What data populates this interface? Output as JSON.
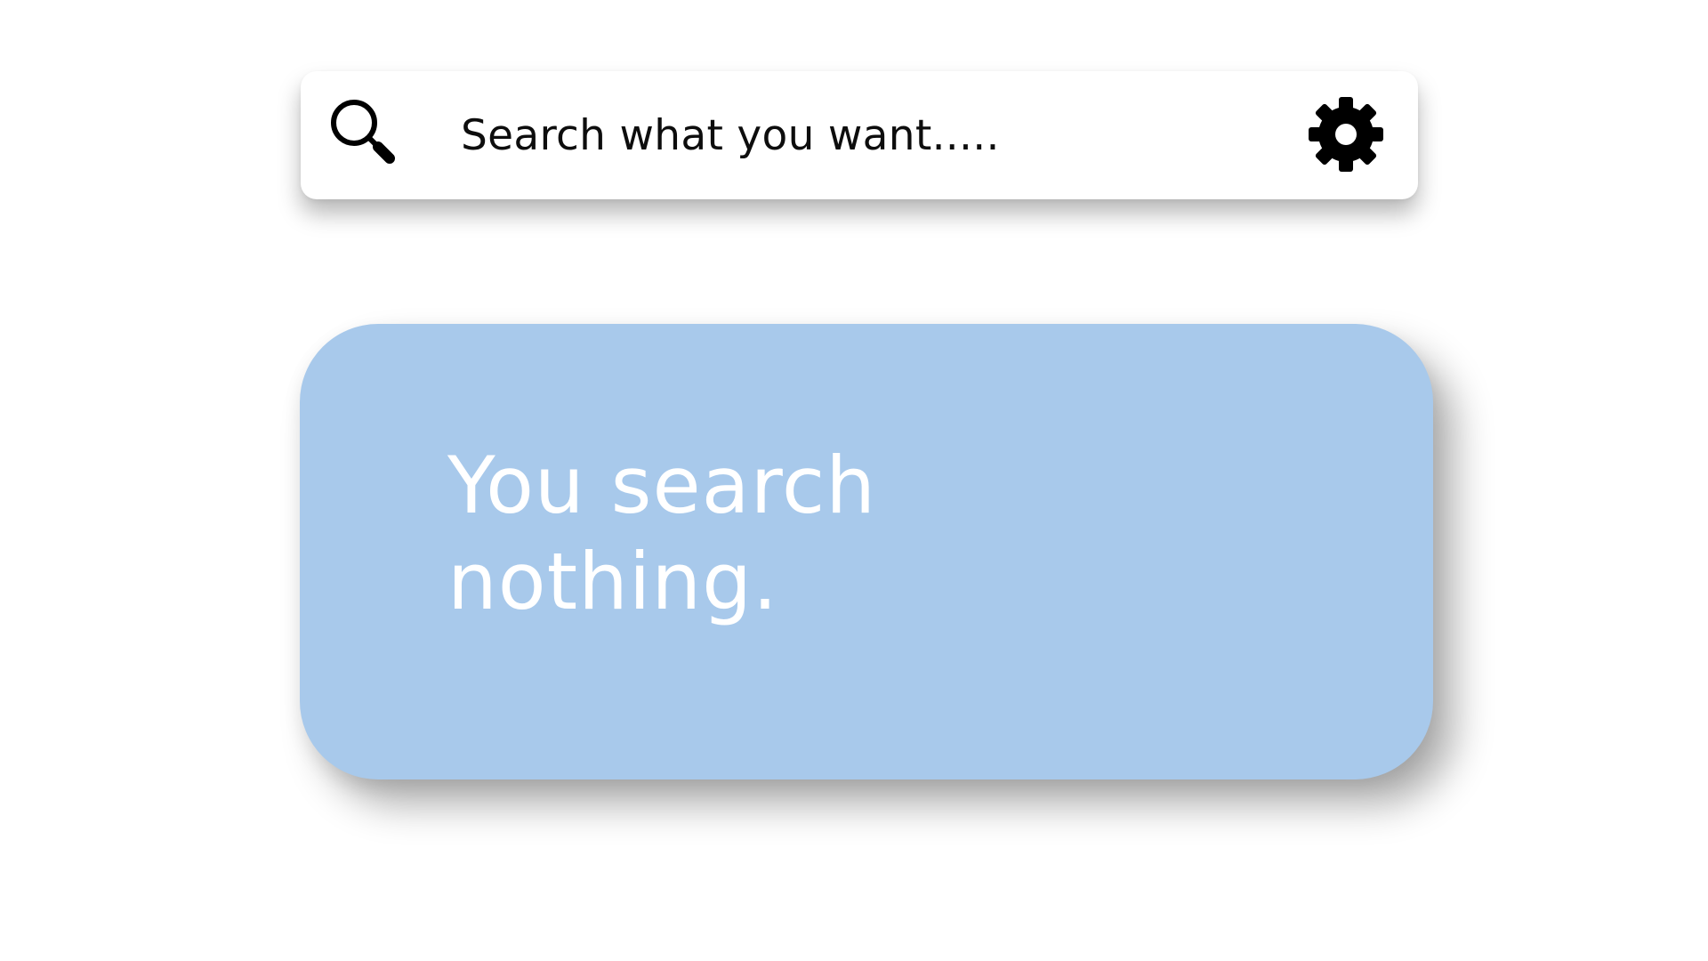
{
  "search": {
    "placeholder": "Search what you want.....",
    "value": "",
    "search_icon": "search-icon",
    "settings_icon": "gear-icon"
  },
  "result": {
    "message": "You search nothing."
  },
  "colors": {
    "background": "#ffffff",
    "search_bar": "#ffffff",
    "result_card": "#a8c9eb",
    "result_text": "#ffffff",
    "icon": "#000000"
  }
}
